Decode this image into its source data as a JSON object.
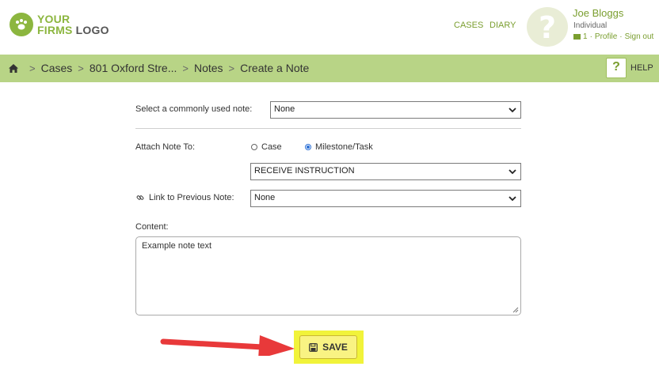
{
  "logo": {
    "line1": "YOUR",
    "line2a": "FIRMS",
    "line2b": " LOGO"
  },
  "nav": {
    "cases": "CASES",
    "diary": "DIARY"
  },
  "user": {
    "avatar_glyph": "?",
    "name": "Joe Bloggs",
    "role": "Individual",
    "message_count": "1",
    "profile": "Profile",
    "signout": "Sign out",
    "separator": "·"
  },
  "breadcrumb": {
    "items": [
      "Cases",
      "801 Oxford Stre...",
      "Notes",
      "Create a Note"
    ],
    "separator": ">"
  },
  "help": {
    "glyph": "?",
    "label": "HELP"
  },
  "form": {
    "common_note_label": "Select a commonly used note:",
    "common_note_value": "None",
    "attach_label": "Attach Note To:",
    "attach_options": [
      "Case",
      "Milestone/Task"
    ],
    "attach_selected": "Milestone/Task",
    "milestone_value": "RECEIVE INSTRUCTION",
    "link_label": "Link to Previous Note:",
    "link_value": "None",
    "content_label": "Content:",
    "content_value": "Example note text"
  },
  "save": {
    "label": "SAVE"
  },
  "colors": {
    "brand_green": "#8cb63f",
    "link_green": "#7a9e2f",
    "crumb_bar": "#b8d486",
    "highlight": "#f1f33a",
    "arrow_red": "#e8393a"
  }
}
